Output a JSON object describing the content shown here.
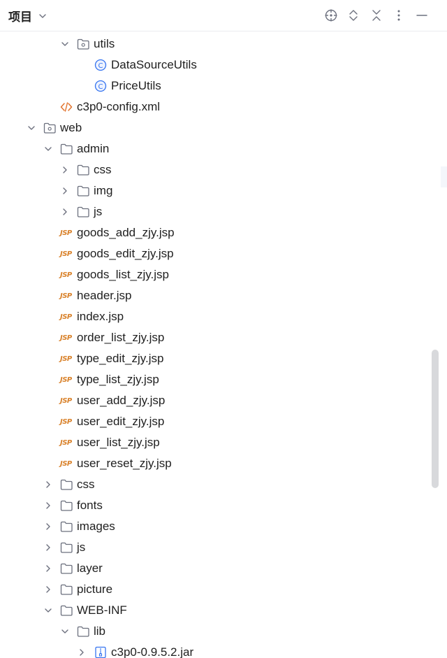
{
  "header": {
    "title": "项目",
    "tools": [
      "locate-icon",
      "expand-all-icon",
      "collapse-all-icon",
      "options-icon",
      "hide-icon"
    ]
  },
  "tree": [
    {
      "label": "utils",
      "type": "package",
      "level": 3,
      "expanded": true
    },
    {
      "label": "DataSourceUtils",
      "type": "class",
      "level": 4
    },
    {
      "label": "PriceUtils",
      "type": "class",
      "level": 4
    },
    {
      "label": "c3p0-config.xml",
      "type": "xml",
      "level": 3
    },
    {
      "label": "web",
      "type": "module",
      "level": 1,
      "expanded": true
    },
    {
      "label": "admin",
      "type": "folder",
      "level": 2,
      "expanded": true
    },
    {
      "label": "css",
      "type": "folder",
      "level": 3,
      "expanded": false
    },
    {
      "label": "img",
      "type": "folder",
      "level": 3,
      "expanded": false
    },
    {
      "label": "js",
      "type": "folder",
      "level": 3,
      "expanded": false
    },
    {
      "label": "goods_add_zjy.jsp",
      "type": "jsp",
      "level": 3
    },
    {
      "label": "goods_edit_zjy.jsp",
      "type": "jsp",
      "level": 3
    },
    {
      "label": "goods_list_zjy.jsp",
      "type": "jsp",
      "level": 3
    },
    {
      "label": "header.jsp",
      "type": "jsp",
      "level": 3
    },
    {
      "label": "index.jsp",
      "type": "jsp",
      "level": 3
    },
    {
      "label": "order_list_zjy.jsp",
      "type": "jsp",
      "level": 3
    },
    {
      "label": "type_edit_zjy.jsp",
      "type": "jsp",
      "level": 3
    },
    {
      "label": "type_list_zjy.jsp",
      "type": "jsp",
      "level": 3
    },
    {
      "label": "user_add_zjy.jsp",
      "type": "jsp",
      "level": 3
    },
    {
      "label": "user_edit_zjy.jsp",
      "type": "jsp",
      "level": 3
    },
    {
      "label": "user_list_zjy.jsp",
      "type": "jsp",
      "level": 3
    },
    {
      "label": "user_reset_zjy.jsp",
      "type": "jsp",
      "level": 3
    },
    {
      "label": "css",
      "type": "folder",
      "level": 2,
      "expanded": false
    },
    {
      "label": "fonts",
      "type": "folder",
      "level": 2,
      "expanded": false
    },
    {
      "label": "images",
      "type": "folder",
      "level": 2,
      "expanded": false
    },
    {
      "label": "js",
      "type": "folder",
      "level": 2,
      "expanded": false
    },
    {
      "label": "layer",
      "type": "folder",
      "level": 2,
      "expanded": false
    },
    {
      "label": "picture",
      "type": "folder",
      "level": 2,
      "expanded": false
    },
    {
      "label": "WEB-INF",
      "type": "folder",
      "level": 2,
      "expanded": true
    },
    {
      "label": "lib",
      "type": "folder",
      "level": 3,
      "expanded": true
    },
    {
      "label": "c3p0-0.9.5.2.jar",
      "type": "jar",
      "level": 4,
      "expanded": false
    }
  ],
  "icons": {
    "jsp_text": "JSP",
    "class_letter": "C"
  },
  "colors": {
    "icon_gray": "#6c707e",
    "class_blue": "#3574f0",
    "jsp_orange": "#d9822b",
    "xml_orange": "#e2742e",
    "scrollbar": "#d8d9dc"
  }
}
